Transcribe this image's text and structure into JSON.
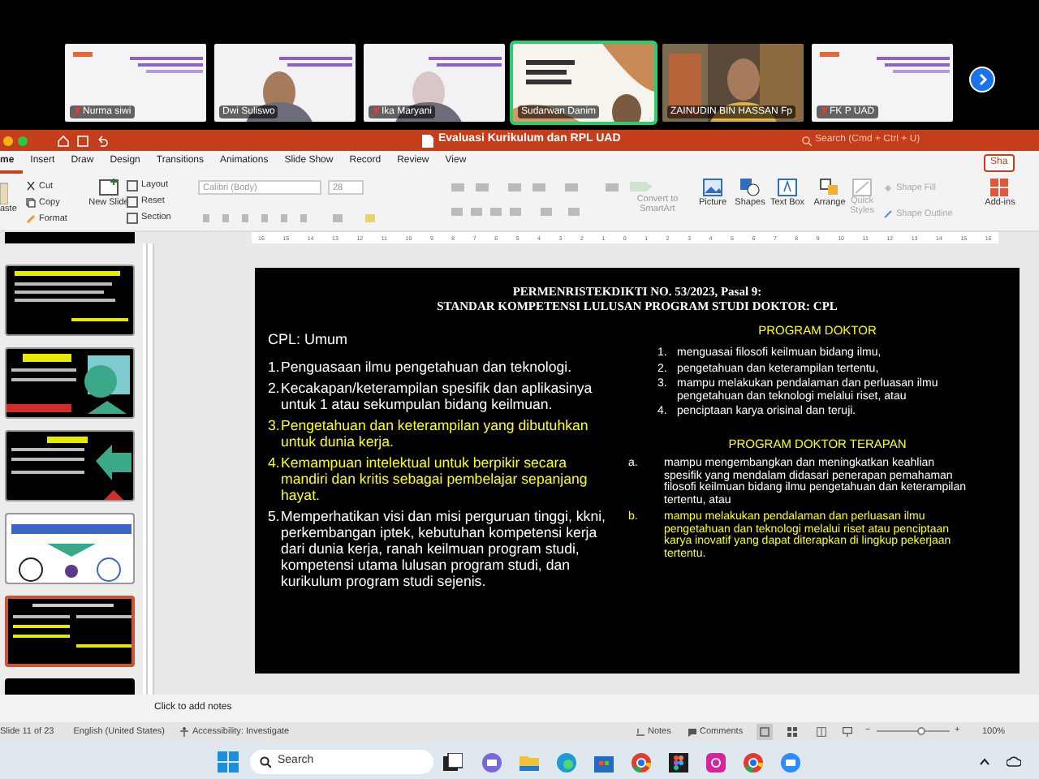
{
  "meeting": {
    "participants": [
      {
        "name": "Nurma siwi",
        "muted": true,
        "speaking": false,
        "kind": "slide"
      },
      {
        "name": "Dwi Suliswo",
        "muted": false,
        "speaking": false,
        "kind": "person"
      },
      {
        "name": "Ika Maryani",
        "muted": true,
        "speaking": false,
        "kind": "person"
      },
      {
        "name": "Sudarwan Danim",
        "muted": false,
        "speaking": true,
        "kind": "slide"
      },
      {
        "name": "ZAINUDIN BIN HASSAN Fp",
        "muted": false,
        "speaking": false,
        "kind": "person"
      },
      {
        "name": "FK P UAD",
        "muted": true,
        "speaking": false,
        "kind": "slide"
      }
    ]
  },
  "window": {
    "title": "Evaluasi Kurikulum dan RPL UAD",
    "search": {
      "placeholder": "Search (Cmd + Ctrl + U)"
    }
  },
  "tabs": [
    {
      "label": "me",
      "selected": true
    },
    {
      "label": "Insert",
      "selected": false
    },
    {
      "label": "Draw",
      "selected": false
    },
    {
      "label": "Design",
      "selected": false
    },
    {
      "label": "Transitions",
      "selected": false
    },
    {
      "label": "Animations",
      "selected": false
    },
    {
      "label": "Slide Show",
      "selected": false
    },
    {
      "label": "Record",
      "selected": false
    },
    {
      "label": "Review",
      "selected": false
    },
    {
      "label": "View",
      "selected": false
    }
  ],
  "share_button": "Sha",
  "ribbon": {
    "paste": "aste",
    "cut": "Cut",
    "copy": "Copy",
    "format": "Format",
    "new_slide": "New Slide",
    "layout": "Layout",
    "reset": "Reset",
    "section": "Section",
    "font": "Calibri (Body)",
    "font_size": "28",
    "convert": "Convert to SmartArt",
    "picture": "Picture",
    "shapes": "Shapes",
    "text_box": "Text Box",
    "arrange": "Arrange",
    "quick_styles": "Quick Styles",
    "shape_fill": "Shape Fill",
    "shape_outline": "Shape Outline",
    "add_ins": "Add-ins"
  },
  "ruler": [
    "16",
    "15",
    "14",
    "13",
    "12",
    "11",
    "10",
    "9",
    "8",
    "7",
    "6",
    "5",
    "4",
    "3",
    "2",
    "1",
    "0",
    "1",
    "2",
    "3",
    "4",
    "5",
    "6",
    "7",
    "8",
    "9",
    "10",
    "11",
    "12",
    "13",
    "14",
    "15",
    "16"
  ],
  "thumbnails": [
    {
      "selected": false
    },
    {
      "selected": false
    },
    {
      "selected": false
    },
    {
      "selected": false
    },
    {
      "selected": true
    }
  ],
  "slide": {
    "title": [
      "PERMENRISTEKDIKTI NO. 53/2023, Pasal 9:",
      "STANDAR KOMPETENSI LULUSAN PROGRAM STUDI DOKTOR: CPL"
    ],
    "left_heading": "CPL: Umum",
    "left_items": [
      {
        "number": "1.",
        "text": "Penguasaan ilmu pengetahuan dan teknologi.",
        "color": "#ffffff"
      },
      {
        "number": "2.",
        "text": "Kecakapan/keterampilan spesifik dan aplikasinya untuk  1 atau sekumpulan bidang keilmuan.",
        "color": "#ffffff"
      },
      {
        "number": "3.",
        "text": "Pengetahuan dan keterampilan yang dibutuhkan untuk dunia kerja.",
        "color": "#ffff00"
      },
      {
        "number": "4.",
        "text": "Kemampuan intelektual untuk berpikir secara mandiri dan kritis sebagai pembelajar sepanjang hayat.",
        "color": "#ffff00"
      },
      {
        "number": "5.",
        "text": "Memperhatikan visi dan misi perguruan tinggi, kkni, perkembangan iptek, kebutuhan kompetensi kerja dari dunia kerja, ranah keilmuan program studi, kompetensi utama lulusan program studi, dan kurikulum program studi sejenis.",
        "color": "#ffffff"
      }
    ],
    "right_sections": [
      {
        "heading": "PROGRAM DOKTOR",
        "items": [
          {
            "number": "1.",
            "text": "menguasai filosofi keilmuan bidang ilmu,",
            "color": "#ffffff"
          },
          {
            "number": "2.",
            "text": "pengetahuan dan keterampilan tertentu,",
            "color": "#ffffff"
          },
          {
            "number": "3.",
            "text": "mampu melakukan pendalaman dan perluasan ilmu pengetahuan dan teknologi melalui riset, atau",
            "color": "#ffffff"
          },
          {
            "number": "4.",
            "text": "penciptaan karya orisinal dan teruji.",
            "color": "#ffffff"
          }
        ]
      },
      {
        "heading": "PROGRAM DOKTOR TERAPAN",
        "items": [
          {
            "number": "a.",
            "text": "mampu mengembangkan dan meningkatkan keahlian spesifik yang mendalam didasari penerapan pemahaman filosofi keilmuan bidang ilmu pengetahuan dan keterampilan tertentu, atau",
            "color": "#ffffff"
          },
          {
            "number": "b.",
            "text": "mampu melakukan pendalaman dan perluasan ilmu pengetahuan dan teknologi melalui riset atau penciptaan karya inovatif yang dapat diterapkan di lingkup pekerjaan tertentu.",
            "color": "#ffff00"
          }
        ]
      }
    ]
  },
  "notes_placeholder": "Click to add notes",
  "status_bar": {
    "slide": "Slide 11 of 23",
    "language": "English (United States)",
    "accessibility": "Accessibility: Investigate",
    "notes": "Notes",
    "comments": "Comments",
    "zoom_out": "−",
    "zoom_in": "+",
    "zoom": "100%",
    "zoom_slider": {
      "level": 0.6
    }
  },
  "taskbar": {
    "search": "Search"
  }
}
